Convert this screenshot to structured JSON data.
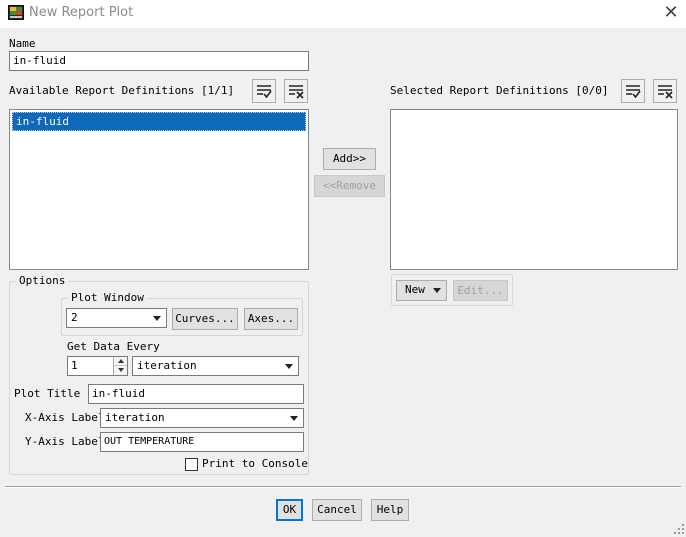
{
  "window": {
    "title": "New Report Plot",
    "close_icon": "close-icon"
  },
  "name_section": {
    "label": "Name",
    "value": "in-fluid"
  },
  "available": {
    "label": "Available Report Definitions [1/1]",
    "items": [
      "in-fluid"
    ]
  },
  "selected": {
    "label": "Selected Report Definitions [0/0]",
    "items": []
  },
  "buttons": {
    "add": "Add>>",
    "remove": "<<Remove",
    "new": "New",
    "edit": "Edit...",
    "curves": "Curves...",
    "axes": "Axes...",
    "ok": "OK",
    "cancel": "Cancel",
    "help": "Help"
  },
  "options": {
    "label": "Options",
    "plot_window": {
      "label": "Plot Window",
      "value": "2"
    },
    "get_data_every": {
      "label": "Get Data Every",
      "count": "1",
      "unit": "iteration"
    },
    "plot_title": {
      "label": "Plot Title",
      "value": "in-fluid"
    },
    "x_axis": {
      "label": "X-Axis Label",
      "value": "iteration"
    },
    "y_axis": {
      "label": "Y-Axis Label",
      "value": "OUT TEMPERATURE"
    },
    "print_to_console": {
      "label": "Print to Console",
      "checked": false
    }
  },
  "colors": {
    "selection": "#0e6ab8",
    "default_button_border": "#0078d7",
    "title_text": "#8a8a8a"
  }
}
